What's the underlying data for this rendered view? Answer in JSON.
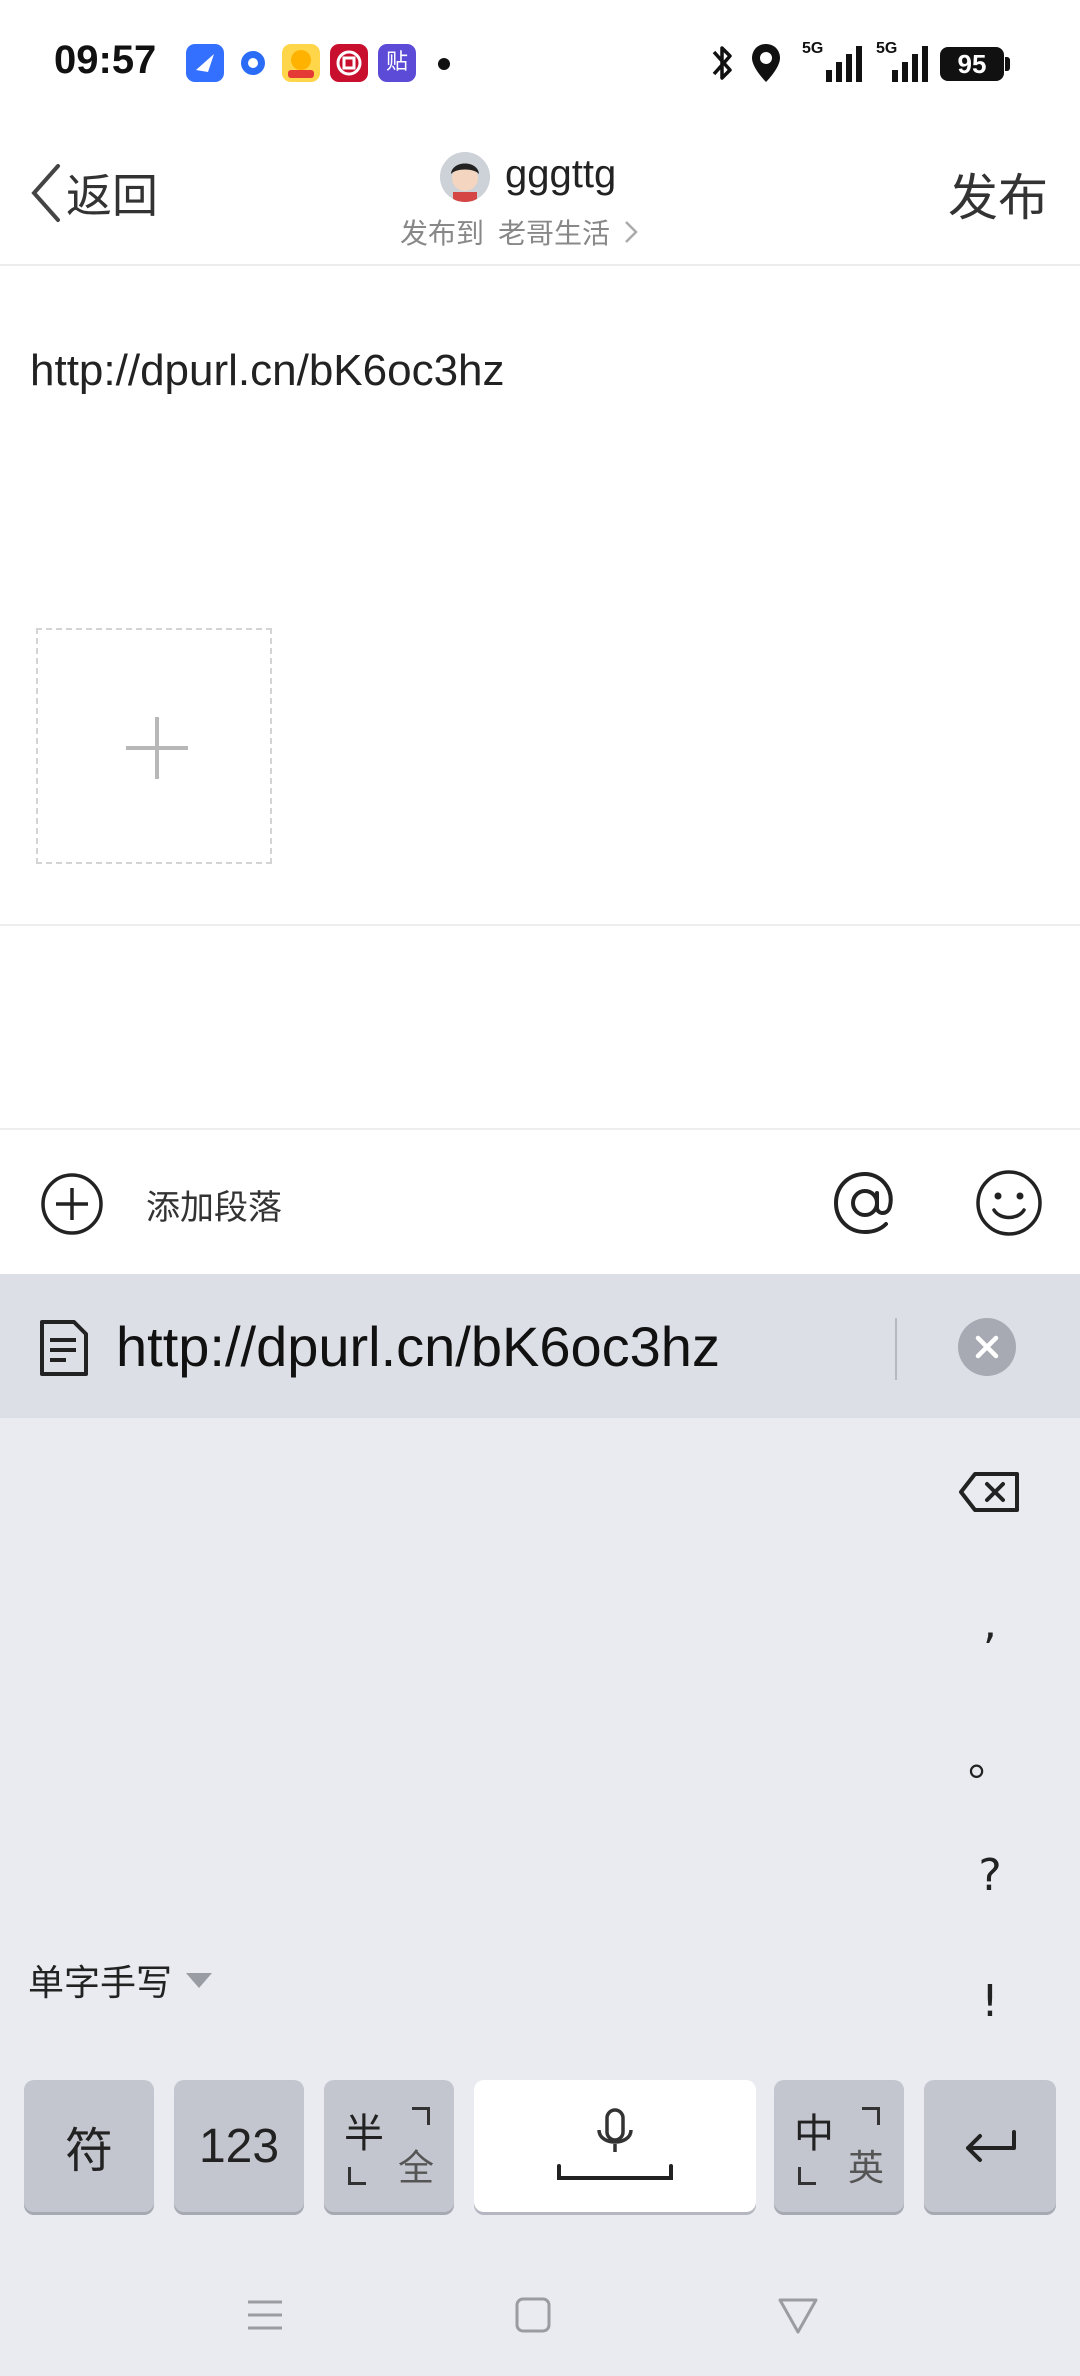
{
  "status_bar": {
    "time": "09:57",
    "battery": "95",
    "network_1": "5G",
    "network_2": "5G",
    "app_icon_label": "贴"
  },
  "nav": {
    "back_label": "返回",
    "username": "gggttg",
    "publish_to_prefix": "发布到",
    "publish_to_target": "老哥生活",
    "publish_label": "发布"
  },
  "editor": {
    "content": "http://dpurl.cn/bK6oc3hz"
  },
  "toolbar": {
    "add_paragraph_label": "添加段落"
  },
  "clipboard": {
    "text": "http://dpurl.cn/bK6oc3hz"
  },
  "keyboard": {
    "side_keys": [
      ",",
      "。",
      "?",
      "!"
    ],
    "handwriting_mode": "单字手写",
    "symbol_key": "符",
    "number_key": "123",
    "half_full_big": "半",
    "half_full_small": "全",
    "lang_big": "中",
    "lang_small": "英"
  }
}
